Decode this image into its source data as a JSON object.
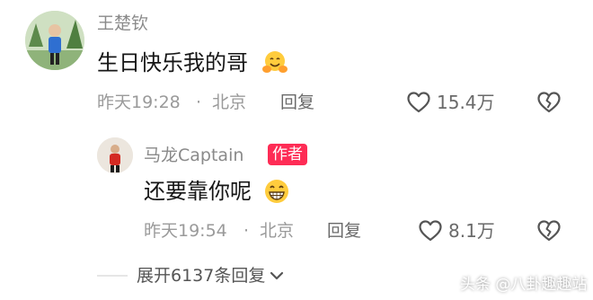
{
  "comment": {
    "author": "王楚钦",
    "text": "生日快乐我的哥",
    "emoji_icon": "hugging-face-icon",
    "time": "昨天19:28",
    "location": "北京",
    "reply_label": "回复",
    "like_count": "15.4万",
    "like_icon": "heart-outline-icon",
    "dislike_icon": "broken-heart-icon"
  },
  "reply": {
    "author": "马龙Captain",
    "badge": "作者",
    "text": "还要靠你呢",
    "emoji_icon": "grinning-face-icon",
    "time": "昨天19:54",
    "location": "北京",
    "reply_label": "回复",
    "like_count": "8.1万",
    "like_icon": "heart-outline-icon",
    "dislike_icon": "broken-heart-icon"
  },
  "expand": {
    "label": "展开6137条回复",
    "icon": "chevron-down-icon"
  },
  "watermark": {
    "prefix": "头条",
    "handle": "@八卦趣趣站"
  },
  "colors": {
    "badge_bg": "#fe2c55",
    "name": "#8a8a8a",
    "meta": "#9a9a9a"
  }
}
